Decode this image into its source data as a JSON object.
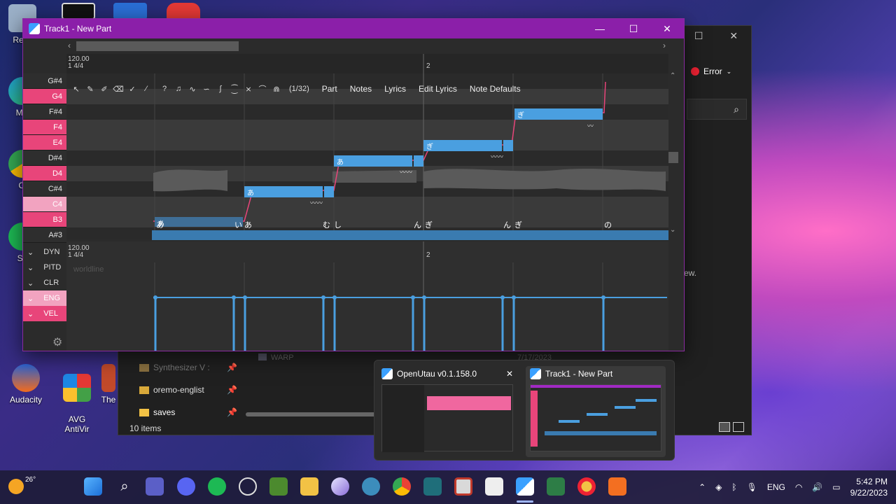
{
  "desktop": {
    "icons": [
      {
        "label": "Recy"
      },
      {
        "label": "Mic"
      },
      {
        "label": "Cl"
      },
      {
        "label": "Sp"
      },
      {
        "label": "Audacity"
      },
      {
        "label": "AVG\nAntiVir"
      },
      {
        "label": "The"
      }
    ]
  },
  "explorer": {
    "error_label": "Error",
    "folders": [
      "Synthesizer V :",
      "oremo-englist",
      "saves"
    ],
    "item_count": "10 items",
    "warp": "WARP",
    "date_hint": "7/17/2023",
    "side_text": "ew."
  },
  "window": {
    "title": "Track1 - New Part",
    "tempo": "120.00",
    "timesig": "1 4/4",
    "bar2": "2",
    "snap": "(1/32)",
    "menus": [
      "Part",
      "Notes",
      "Lyrics",
      "Edit Lyrics",
      "Note Defaults"
    ],
    "keys": [
      "G#4",
      "G4",
      "F#4",
      "F4",
      "E4",
      "D#4",
      "D4",
      "C#4",
      "C4",
      "B3",
      "A#3"
    ],
    "lyrics_row": [
      "あ",
      "い",
      "あ",
      "む",
      "し",
      "ん",
      "ぎ",
      "ん",
      "ぎ",
      "の"
    ],
    "note_lyrics": [
      "あ",
      "あ",
      "あ",
      "ぎ",
      "ぎ"
    ]
  },
  "expressions": {
    "tempo": "120.00",
    "timesig": "1 4/4",
    "bar2": "2",
    "labels": [
      "DYN",
      "PITD",
      "CLR",
      "ENG",
      "VEL"
    ],
    "hint": "worldline"
  },
  "thumbnails": [
    {
      "title": "OpenUtau v0.1.158.0"
    },
    {
      "title": "Track1 - New Part"
    }
  ],
  "taskbar": {
    "weather": "26°",
    "lang": "ENG",
    "time": "5:42 PM",
    "date": "9/22/2023"
  },
  "colors": {
    "title_bar": "#8b1fa9",
    "key_pink": "#e8457a",
    "note_blue": "#4a9fe0"
  }
}
